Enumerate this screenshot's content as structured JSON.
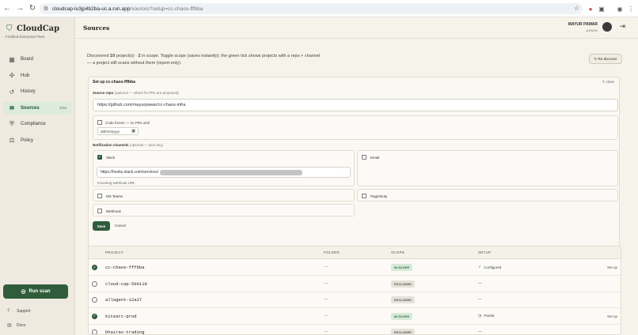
{
  "browser": {
    "url_host": "cloudcap-lu3jp4b2ba-uc.a.run.app",
    "url_path": "/sources?setup=cc-chaos-fffbba"
  },
  "sidebar": {
    "brand": "CloudCap",
    "tagline": "Fortified Enterprise Fleet",
    "items": [
      {
        "label": "Board",
        "icon": "grid-icon"
      },
      {
        "label": "Hub",
        "icon": "hub-icon"
      },
      {
        "label": "History",
        "icon": "history-icon"
      },
      {
        "label": "Sources",
        "icon": "database-icon",
        "badge": "2/10"
      },
      {
        "label": "Compliance",
        "icon": "shield-check-icon"
      },
      {
        "label": "Policy",
        "icon": "scale-icon"
      }
    ],
    "run_scan": "Run scan",
    "support": "Support",
    "docs": "Docs"
  },
  "header": {
    "title": "Sources",
    "user_name": "MAYUR PAWAR",
    "user_role": "ADMIN"
  },
  "intro": {
    "part1": "Discovered ",
    "count": "10",
    "part2": " project(s) · ",
    "in_scope": "2",
    "part3": " in scope. Toggle scope (saves instantly); the green tick shows projects with a repo + channel — a project still scans without them (report-only)."
  },
  "rediscover_label": "↻ Re-discover",
  "setup": {
    "title": "Set up cc-chaos-fffbba",
    "close_label": "✕ close",
    "repo_label": "Source repo",
    "repo_hint": "(optional — where fix PRs are proposed)",
    "repo_value": "https://github.com/mayurpawar/cc-chaos-infra",
    "frozen_label": "Code frozen — no PRs until",
    "date_placeholder": "dd/mm/yyyy",
    "channels_label": "Notification channels",
    "channels_hint": "(optional — pick any)",
    "slack_label": "Slack",
    "slack_value_prefix": "https://hooks.slack.com/services/",
    "slack_helper": "Incoming webhook URL",
    "email_label": "Email",
    "teams_label": "MS Teams",
    "pagerduty_label": "PagerDuty",
    "webhook_label": "Webhook",
    "save_label": "Save",
    "cancel_label": "Cancel"
  },
  "table": {
    "headers": [
      "PROJECT",
      "FOLDER",
      "SCOPE",
      "SETUP"
    ],
    "rows": [
      {
        "checked": true,
        "project": "cc-chaos-fffbba",
        "folder": "—",
        "scope": "IN SCOPE",
        "scope_kind": "in",
        "setup_icon": "check-circle-icon",
        "setup": "Configured",
        "action": "Set up"
      },
      {
        "checked": false,
        "project": "cloud-cap-506110",
        "folder": "—",
        "scope": "EXCLUDED",
        "scope_kind": "ex",
        "setup_icon": "",
        "setup": "—",
        "action": ""
      },
      {
        "checked": false,
        "project": "allagent-12a27",
        "folder": "—",
        "scope": "EXCLUDED",
        "scope_kind": "ex",
        "setup_icon": "",
        "setup": "—",
        "action": ""
      },
      {
        "checked": true,
        "project": "kitearc-prod",
        "folder": "—",
        "scope": "IN SCOPE",
        "scope_kind": "in",
        "setup_icon": "clock-icon",
        "setup": "Partial",
        "action": "Set up"
      },
      {
        "checked": false,
        "project": "bhairav-trading",
        "folder": "—",
        "scope": "EXCLUDED",
        "scope_kind": "ex",
        "setup_icon": "",
        "setup": "—",
        "action": ""
      }
    ]
  },
  "colors": {
    "accent": "#2f5d3c",
    "background": "#f6f3ea",
    "sidebar": "#eeeadf",
    "in_scope_bg": "#d7ead8"
  }
}
